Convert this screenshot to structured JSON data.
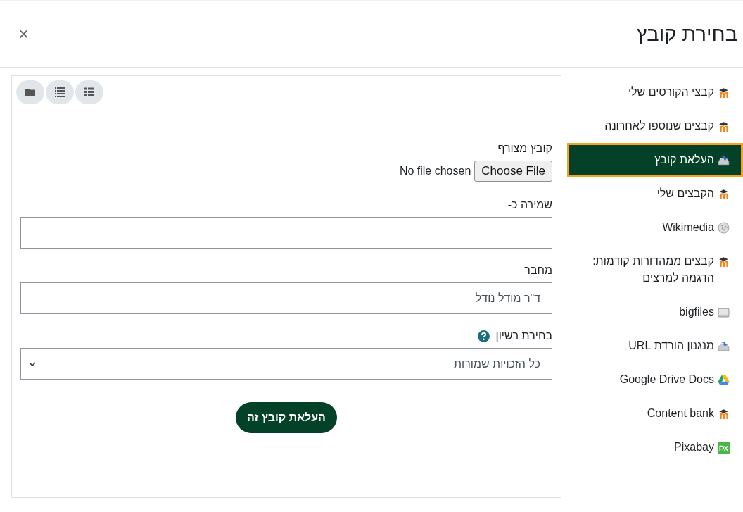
{
  "dialog": {
    "title": "בחירת קובץ",
    "close": "×"
  },
  "sidebar": {
    "items": [
      {
        "label": "קבצי הקורסים שלי",
        "kind": "moodle",
        "selected": false
      },
      {
        "label": "קבצים שנוספו לאחרונה",
        "kind": "moodle",
        "selected": false
      },
      {
        "label": "העלאת קובץ",
        "kind": "upload",
        "selected": true
      },
      {
        "label": "הקבצים שלי",
        "kind": "moodle",
        "selected": false
      },
      {
        "label": "Wikimedia",
        "kind": "globe",
        "selected": false
      },
      {
        "label": "קבצים ממהדורות קודמות: הדגמה למרצים",
        "kind": "moodle",
        "selected": false
      },
      {
        "label": "bigfiles",
        "kind": "drive",
        "selected": false
      },
      {
        "label": "מנגנון הורדת URL",
        "kind": "upload",
        "selected": false
      },
      {
        "label": "Google Drive Docs",
        "kind": "gdrive",
        "selected": false
      },
      {
        "label": "Content bank",
        "kind": "moodle",
        "selected": false
      },
      {
        "label": "Pixabay",
        "kind": "pixabay",
        "selected": false
      }
    ]
  },
  "view_buttons": [
    {
      "kind": "folder"
    },
    {
      "kind": "list"
    },
    {
      "kind": "grid"
    }
  ],
  "form": {
    "attachment_label": "קובץ מצורף",
    "choose_button": "Choose File",
    "file_status": "No file chosen",
    "save_as_label": "שמירה כ-",
    "author_label": "מחבר",
    "author_value": "ד\"ר מודל נודל",
    "license_label": "בחירת רשיון",
    "license_value": "כל הזכויות שמורות",
    "submit": "העלאת קובץ זה"
  }
}
